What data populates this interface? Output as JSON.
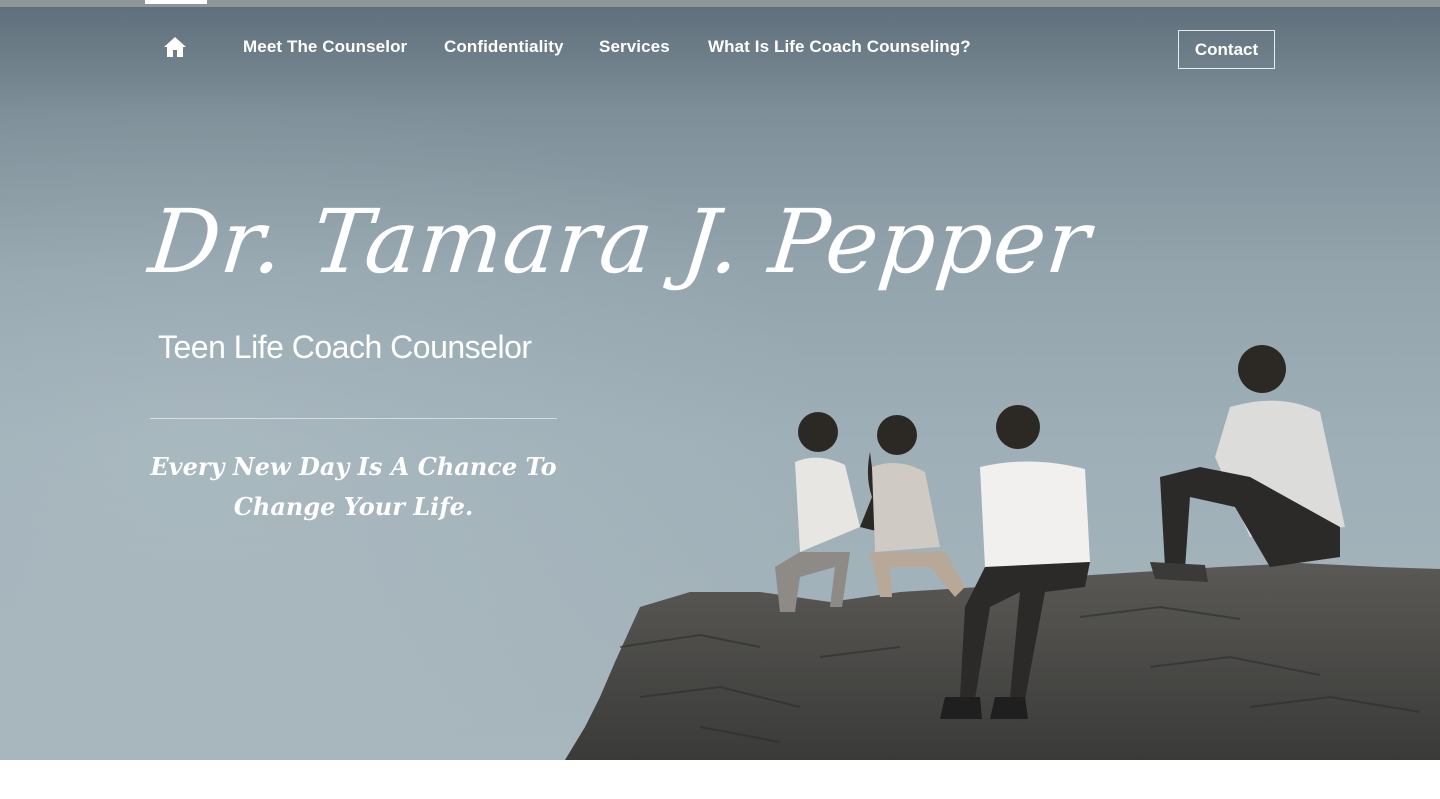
{
  "nav": {
    "home_icon": "home-icon",
    "links": [
      {
        "label": "Meet The Counselor"
      },
      {
        "label": "Confidentiality"
      },
      {
        "label": "Services"
      },
      {
        "label": "What Is Life Coach Counseling?"
      }
    ],
    "contact_label": "Contact"
  },
  "hero": {
    "title": "Dr. Tamara J. Pepper",
    "subtitle": "Teen Life Coach Counselor",
    "tagline": "Every New Day Is A Chance To Change Your Life.",
    "image_description": "four-teens-sitting-on-rocky-cliff"
  },
  "colors": {
    "sky_top": "#5f6f7b",
    "sky_bottom": "#a8b6bd",
    "rock": "#4a4947",
    "text": "#ffffff"
  }
}
